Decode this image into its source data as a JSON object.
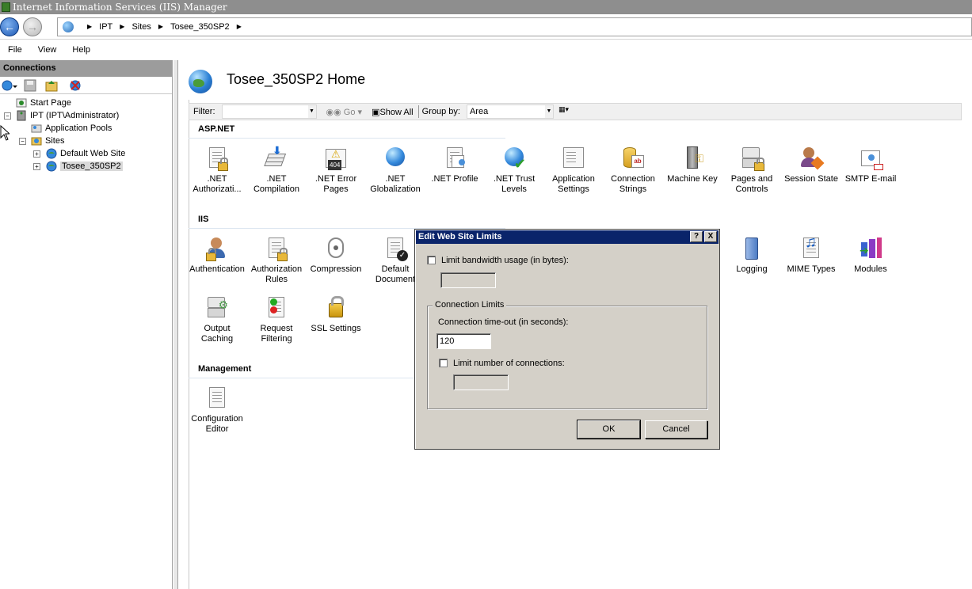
{
  "window": {
    "title": "Internet Information Services (IIS) Manager"
  },
  "address": {
    "crumbs": [
      "IPT",
      "Sites",
      "Tosee_350SP2"
    ]
  },
  "menu": {
    "items": [
      "File",
      "View",
      "Help"
    ]
  },
  "connections": {
    "header": "Connections",
    "tree": [
      {
        "label": "Start Page"
      },
      {
        "label": "IPT (IPT\\Administrator)"
      },
      {
        "label": "Application Pools"
      },
      {
        "label": "Sites"
      },
      {
        "label": "Default Web Site"
      },
      {
        "label": "Tosee_350SP2"
      }
    ]
  },
  "main": {
    "title": "Tosee_350SP2 Home",
    "filter": {
      "label": "Filter:",
      "go": "Go",
      "show_all": "Show All",
      "group_by_label": "Group by:",
      "group_by_value": "Area"
    },
    "sections": {
      "aspnet": "ASP.NET",
      "iis": "IIS",
      "management": "Management"
    },
    "aspnet_features": [
      {
        "l1": ".NET",
        "l2": "Authorizati..."
      },
      {
        "l1": ".NET",
        "l2": "Compilation"
      },
      {
        "l1": ".NET Error",
        "l2": "Pages"
      },
      {
        "l1": ".NET",
        "l2": "Globalization"
      },
      {
        "l1": ".NET Profile",
        "l2": ""
      },
      {
        "l1": ".NET Trust",
        "l2": "Levels"
      },
      {
        "l1": "Application",
        "l2": "Settings"
      },
      {
        "l1": "Connection",
        "l2": "Strings"
      },
      {
        "l1": "Machine Key",
        "l2": ""
      },
      {
        "l1": "Pages and",
        "l2": "Controls"
      },
      {
        "l1": "Session State",
        "l2": ""
      },
      {
        "l1": "SMTP E-mail",
        "l2": ""
      }
    ],
    "iis_features": [
      {
        "l1": "Authentication",
        "l2": ""
      },
      {
        "l1": "Authorization",
        "l2": "Rules"
      },
      {
        "l1": "Compression",
        "l2": ""
      },
      {
        "l1": "Default",
        "l2": "Document"
      },
      {
        "l1": "Logging",
        "l2": ""
      },
      {
        "l1": "MIME Types",
        "l2": ""
      },
      {
        "l1": "Modules",
        "l2": ""
      },
      {
        "l1": "Output",
        "l2": "Caching"
      },
      {
        "l1": "Request",
        "l2": "Filtering"
      },
      {
        "l1": "SSL Settings",
        "l2": ""
      }
    ],
    "management_features": [
      {
        "l1": "Configuration",
        "l2": "Editor"
      }
    ]
  },
  "dialog": {
    "title": "Edit Web Site Limits",
    "help_btn": "?",
    "close_btn": "X",
    "limit_bandwidth_label": "Limit bandwidth usage (in bytes):",
    "limit_bandwidth_checked": false,
    "bandwidth_value": "",
    "connection_limits_group": "Connection Limits",
    "timeout_label": "Connection time-out (in seconds):",
    "timeout_value": "120",
    "limit_connections_label": "Limit number of connections:",
    "limit_connections_checked": false,
    "connections_value": "",
    "ok": "OK",
    "cancel": "Cancel"
  },
  "colors": {
    "dialog_title_bg": "#0a246a",
    "dialog_face": "#d4d0c8",
    "pane_header": "#9c9c9c"
  }
}
